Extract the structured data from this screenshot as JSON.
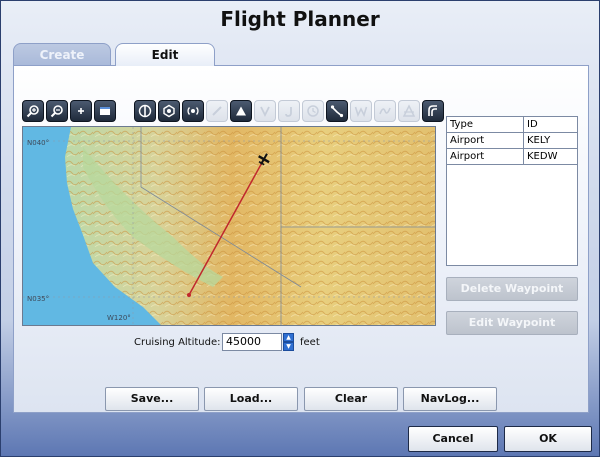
{
  "window": {
    "title": "Flight Planner"
  },
  "tabs": [
    {
      "label": "Create",
      "active": false
    },
    {
      "label": "Edit",
      "active": true
    }
  ],
  "toolbar": {
    "icons": [
      "zoom-in-icon",
      "zoom-out-icon",
      "center-plus-icon",
      "window-icon",
      "vor-icon",
      "ndb-icon",
      "radio-icon",
      "slash-icon",
      "triangle-icon",
      "v-icon",
      "j-icon",
      "clock-icon",
      "route-icon",
      "w-icon",
      "wave-icon",
      "ats-icon",
      "path-icon"
    ]
  },
  "map": {
    "labels": {
      "lat_top": "N040°",
      "lat_bottom": "N035°",
      "lon_bottom": "W120°"
    },
    "route_color": "#c0282d"
  },
  "waypoints": {
    "headers": [
      "Type",
      "ID"
    ],
    "rows": [
      {
        "type": "Airport",
        "id": "KELY"
      },
      {
        "type": "Airport",
        "id": "KEDW"
      }
    ]
  },
  "actions": {
    "delete_waypoint": "Delete Waypoint",
    "edit_waypoint": "Edit Waypoint"
  },
  "altitude": {
    "label": "Cruising Altitude:",
    "value": "45000",
    "unit": "feet"
  },
  "file_buttons": {
    "save": "Save...",
    "load": "Load...",
    "clear": "Clear",
    "navlog": "NavLog..."
  },
  "dialog_buttons": {
    "cancel": "Cancel",
    "ok": "OK"
  }
}
